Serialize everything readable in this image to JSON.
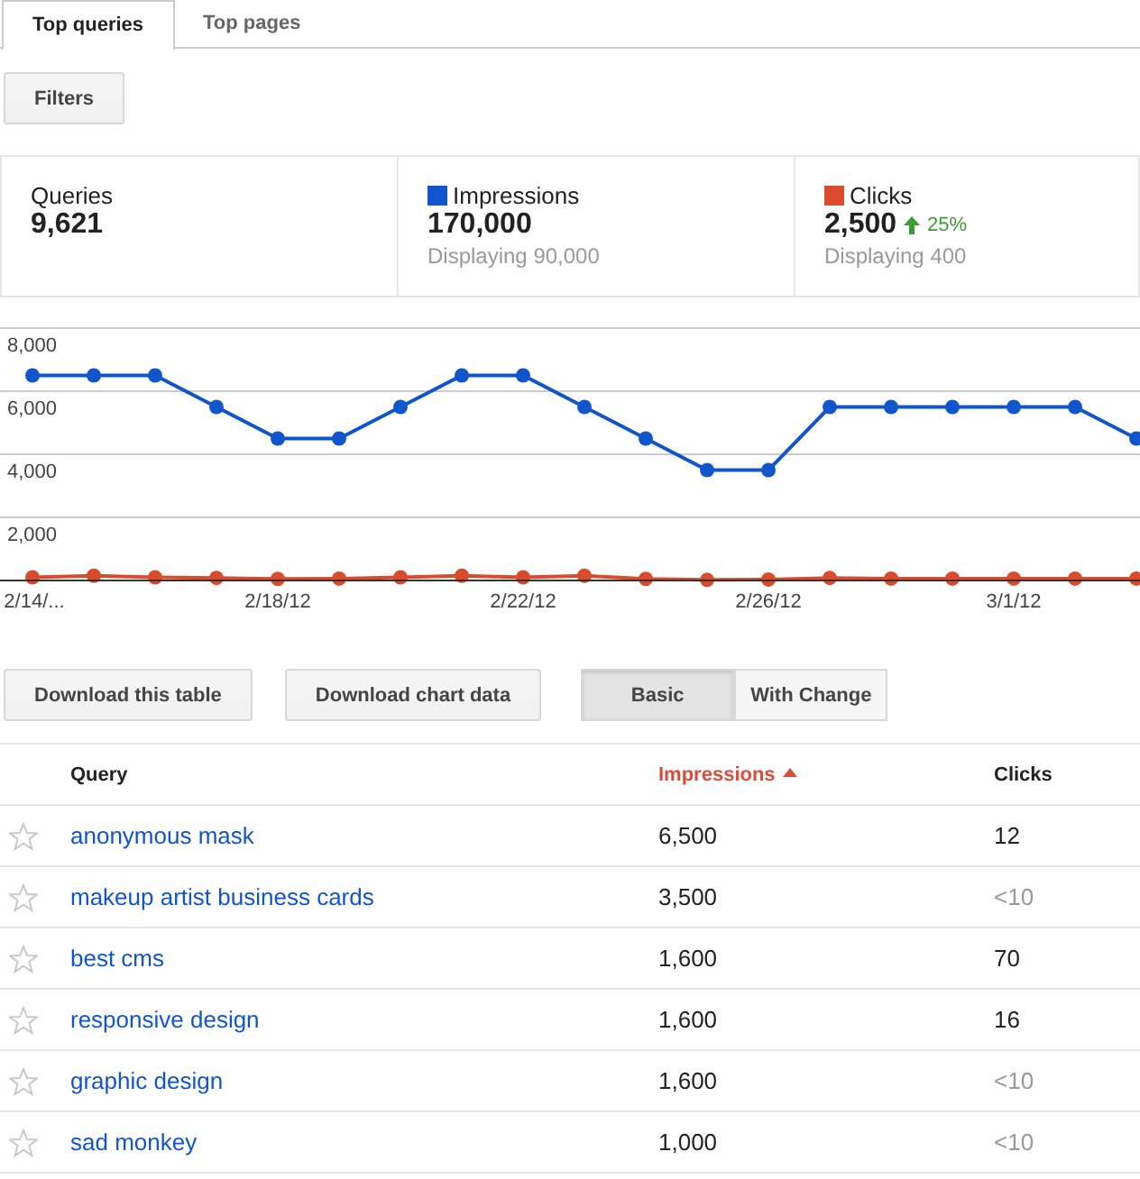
{
  "tabs": [
    {
      "label": "Top queries",
      "selected": true
    },
    {
      "label": "Top pages",
      "selected": false
    }
  ],
  "filters_button": "Filters",
  "summary": [
    {
      "label": "Queries",
      "value": "9,621"
    },
    {
      "label": "Impressions",
      "value": "170,000",
      "color": "#1155cc",
      "subtext": "Displaying 90,000"
    },
    {
      "label": "Clicks",
      "value": "2,500",
      "color": "#dc4a2c",
      "change": "25%",
      "subtext": "Displaying 400"
    }
  ],
  "chart_data": {
    "type": "line",
    "categories": [
      "2/14/...",
      null,
      null,
      null,
      "2/18/12",
      null,
      null,
      null,
      "2/22/12",
      null,
      null,
      null,
      "2/26/12",
      null,
      null,
      null,
      "3/1/12",
      null,
      null
    ],
    "ylim": [
      0,
      8000
    ],
    "grid": true,
    "yticks": [
      {
        "value": 2000,
        "label": "2,000"
      },
      {
        "value": 4000,
        "label": "4,000"
      },
      {
        "value": 6000,
        "label": "6,000"
      },
      {
        "value": 8000,
        "label": "8,000"
      }
    ],
    "series": [
      {
        "color": "#1155cc",
        "marker": "circle",
        "values": [
          6500,
          6500,
          6500,
          5500,
          4500,
          4500,
          5500,
          6500,
          6500,
          5500,
          4500,
          3500,
          3500,
          5500,
          5500,
          5500,
          5500,
          5500,
          4500
        ]
      },
      {
        "color": "#dc4a2c",
        "marker": "circle",
        "values": [
          100,
          150,
          100,
          80,
          50,
          60,
          100,
          150,
          100,
          150,
          50,
          20,
          30,
          80,
          60,
          60,
          60,
          60,
          60
        ]
      }
    ]
  },
  "actions": [
    "Download this table",
    "Download chart data"
  ],
  "view_toggle": [
    {
      "label": "Basic",
      "selected": true
    },
    {
      "label": "With Change",
      "selected": false
    }
  ],
  "table": {
    "columns": [
      {
        "label": "Query",
        "sorted": false
      },
      {
        "label": "Impressions",
        "sorted": true
      },
      {
        "label": "Clicks",
        "sorted": false
      }
    ],
    "rows": [
      {
        "starred": false,
        "query": "anonymous mask",
        "impressions": "6,500",
        "clicks": "12",
        "clicks_muted": false
      },
      {
        "starred": false,
        "query": "makeup artist business cards",
        "impressions": "3,500",
        "clicks": "<10",
        "clicks_muted": true
      },
      {
        "starred": false,
        "query": "best cms",
        "impressions": "1,600",
        "clicks": "70",
        "clicks_muted": false
      },
      {
        "starred": false,
        "query": "responsive design",
        "impressions": "1,600",
        "clicks": "16",
        "clicks_muted": false
      },
      {
        "starred": false,
        "query": "graphic design",
        "impressions": "1,600",
        "clicks": "<10",
        "clicks_muted": true
      },
      {
        "starred": false,
        "query": "sad monkey",
        "impressions": "1,000",
        "clicks": "<10",
        "clicks_muted": true
      }
    ]
  }
}
